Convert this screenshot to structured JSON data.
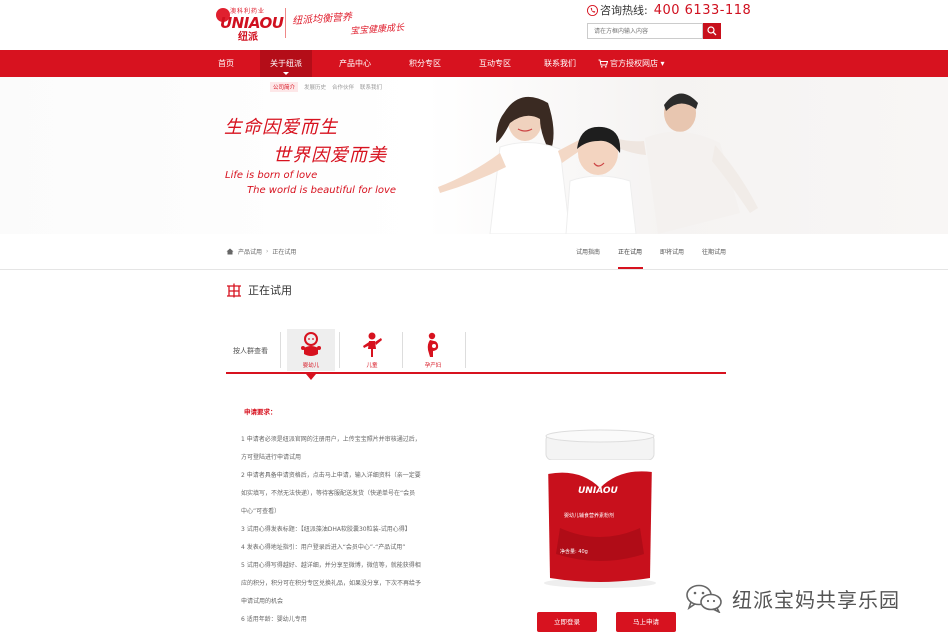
{
  "header": {
    "logo_en": "UNIAOU",
    "logo_cn": "纽派",
    "logo_top": "澳科利药业",
    "slogan_line1": "纽派均衡营养",
    "slogan_line2": "宝宝健康成长",
    "hotline_label": "咨询热线:",
    "hotline_number": "400 6133-118",
    "search_placeholder": "请在方框内输入内容"
  },
  "nav": {
    "items": [
      {
        "label": "首页"
      },
      {
        "label": "关于纽派"
      },
      {
        "label": "产品中心"
      },
      {
        "label": "积分专区"
      },
      {
        "label": "互动专区"
      },
      {
        "label": "联系我们"
      },
      {
        "label": "官方授权网店 ▾"
      }
    ],
    "subnav": [
      "公司简介",
      "发展历史",
      "合作伙伴",
      "联系我们"
    ]
  },
  "banner": {
    "cn_line1": "生命因爱而生",
    "cn_line2": "世界因爱而美",
    "en_line1": "Life is born of love",
    "en_line2": "The world is beautiful for love"
  },
  "breadcrumb": {
    "items": [
      "产品试用",
      "正在试用"
    ],
    "separator": "›"
  },
  "tabs": [
    "试用指南",
    "正在试用",
    "即将试用",
    "往期试用"
  ],
  "section_title": "正在试用",
  "crowd": {
    "label": "按人群查看",
    "items": [
      {
        "label": "婴幼儿",
        "icon": "baby-icon"
      },
      {
        "label": "儿童",
        "icon": "child-icon"
      },
      {
        "label": "孕产妇",
        "icon": "pregnant-icon"
      }
    ]
  },
  "requirements": {
    "title": "申请要求：",
    "lines": [
      "1 申请者必须是纽派官网的注册用户，上传宝宝照片并审核通过后，",
      "方可登陆进行申请试用",
      "2 申请者具备申请资格后，点击马上申请，输入详细资料（亲一定要",
      "如实填写，不然无法快递），等待客服配送发货（快递单号在“会员",
      "中心”可查看）",
      "3 试用心得发表标题：【纽派藻油DHA软胶囊30粒装-试用心得】",
      "4 发表心得地址指引：用户登录后进入“会员中心”-“产品试用”",
      "5 试用心得写得越好、越详细，并分享至微博，微信等，就能获得相",
      "应的积分，积分可在积分专区兑换礼品，如果没分享，下次不再给予",
      "申请试用的机会",
      "6 适用年龄：婴幼儿专用"
    ]
  },
  "product": {
    "brand": "UNIAOU",
    "name": "婴幼儿辅食营养素粉剂",
    "weight": "净含量: 40g"
  },
  "buttons": {
    "login": "立即登录",
    "apply": "马上申请"
  },
  "watermark": "纽派宝妈共享乐园",
  "colors": {
    "brand_red": "#d7121f",
    "nav_active": "#b40d18"
  }
}
